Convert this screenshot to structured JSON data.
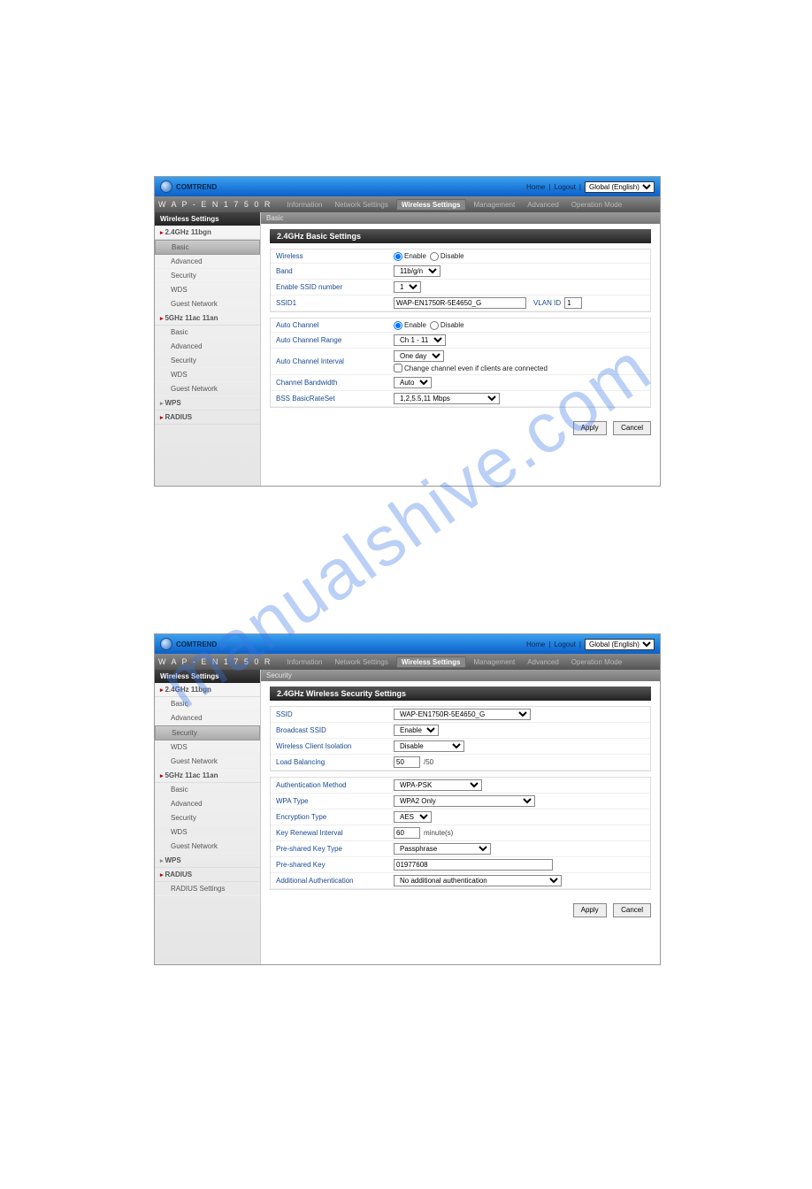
{
  "header": {
    "brand": "COMTREND",
    "home": "Home",
    "logout": "Logout",
    "lang": "Global (English)"
  },
  "nav": {
    "model": "W A P - E N 1 7 5 0 R",
    "tabs": [
      "Information",
      "Network Settings",
      "Wireless Settings",
      "Management",
      "Advanced",
      "Operation Mode"
    ],
    "active": "Wireless Settings"
  },
  "side": {
    "title": "Wireless Settings",
    "g24": "2.4GHz 11bgn",
    "g24_items": [
      "Basic",
      "Advanced",
      "Security",
      "WDS",
      "Guest Network"
    ],
    "g5": "5GHz 11ac 11an",
    "g5_items": [
      "Basic",
      "Advanced",
      "Security",
      "WDS",
      "Guest Network"
    ],
    "wps": "WPS",
    "radius": "RADIUS",
    "radius_items": [
      "RADIUS Settings"
    ]
  },
  "screen1": {
    "crumb": "Basic",
    "title": "2.4GHz Basic Settings",
    "active_item": "Basic",
    "labels": {
      "wireless": "Wireless",
      "band": "Band",
      "ssidnum": "Enable SSID number",
      "ssid1": "SSID1",
      "vlanid": "VLAN ID",
      "autoch": "Auto Channel",
      "autochrange": "Auto Channel Range",
      "autochint": "Auto Channel Interval",
      "chkchange": "Change channel even if clients are connected",
      "chbw": "Channel Bandwidth",
      "bss": "BSS BasicRateSet"
    },
    "values": {
      "enable": "Enable",
      "disable": "Disable",
      "band": "11b/g/n",
      "ssidnum": "1",
      "ssid1": "WAP-EN1750R-5E4650_G",
      "vlanid": "1",
      "autochrange": "Ch 1 - 11",
      "autochint": "One day",
      "chbw": "Auto",
      "bss": "1,2,5.5,11 Mbps"
    }
  },
  "screen2": {
    "crumb": "Security",
    "title": "2.4GHz Wireless Security Settings",
    "active_item": "Security",
    "labels": {
      "ssid": "SSID",
      "bcast": "Broadcast SSID",
      "iso": "Wireless Client Isolation",
      "load": "Load Balancing",
      "auth": "Authentication Method",
      "wpatype": "WPA Type",
      "enc": "Encryption Type",
      "keyren": "Key Renewal Interval",
      "psktype": "Pre-shared Key Type",
      "psk": "Pre-shared Key",
      "addauth": "Additional Authentication"
    },
    "values": {
      "ssid": "WAP-EN1750R-5E4650_G",
      "bcast": "Enable",
      "iso": "Disable",
      "load": "50",
      "load_suffix": "/50",
      "auth": "WPA-PSK",
      "wpatype": "WPA2 Only",
      "enc": "AES",
      "keyren": "60",
      "keyren_suffix": "minute(s)",
      "psktype": "Passphrase",
      "psk": "01977608",
      "addauth": "No additional authentication"
    }
  },
  "buttons": {
    "apply": "Apply",
    "cancel": "Cancel"
  }
}
